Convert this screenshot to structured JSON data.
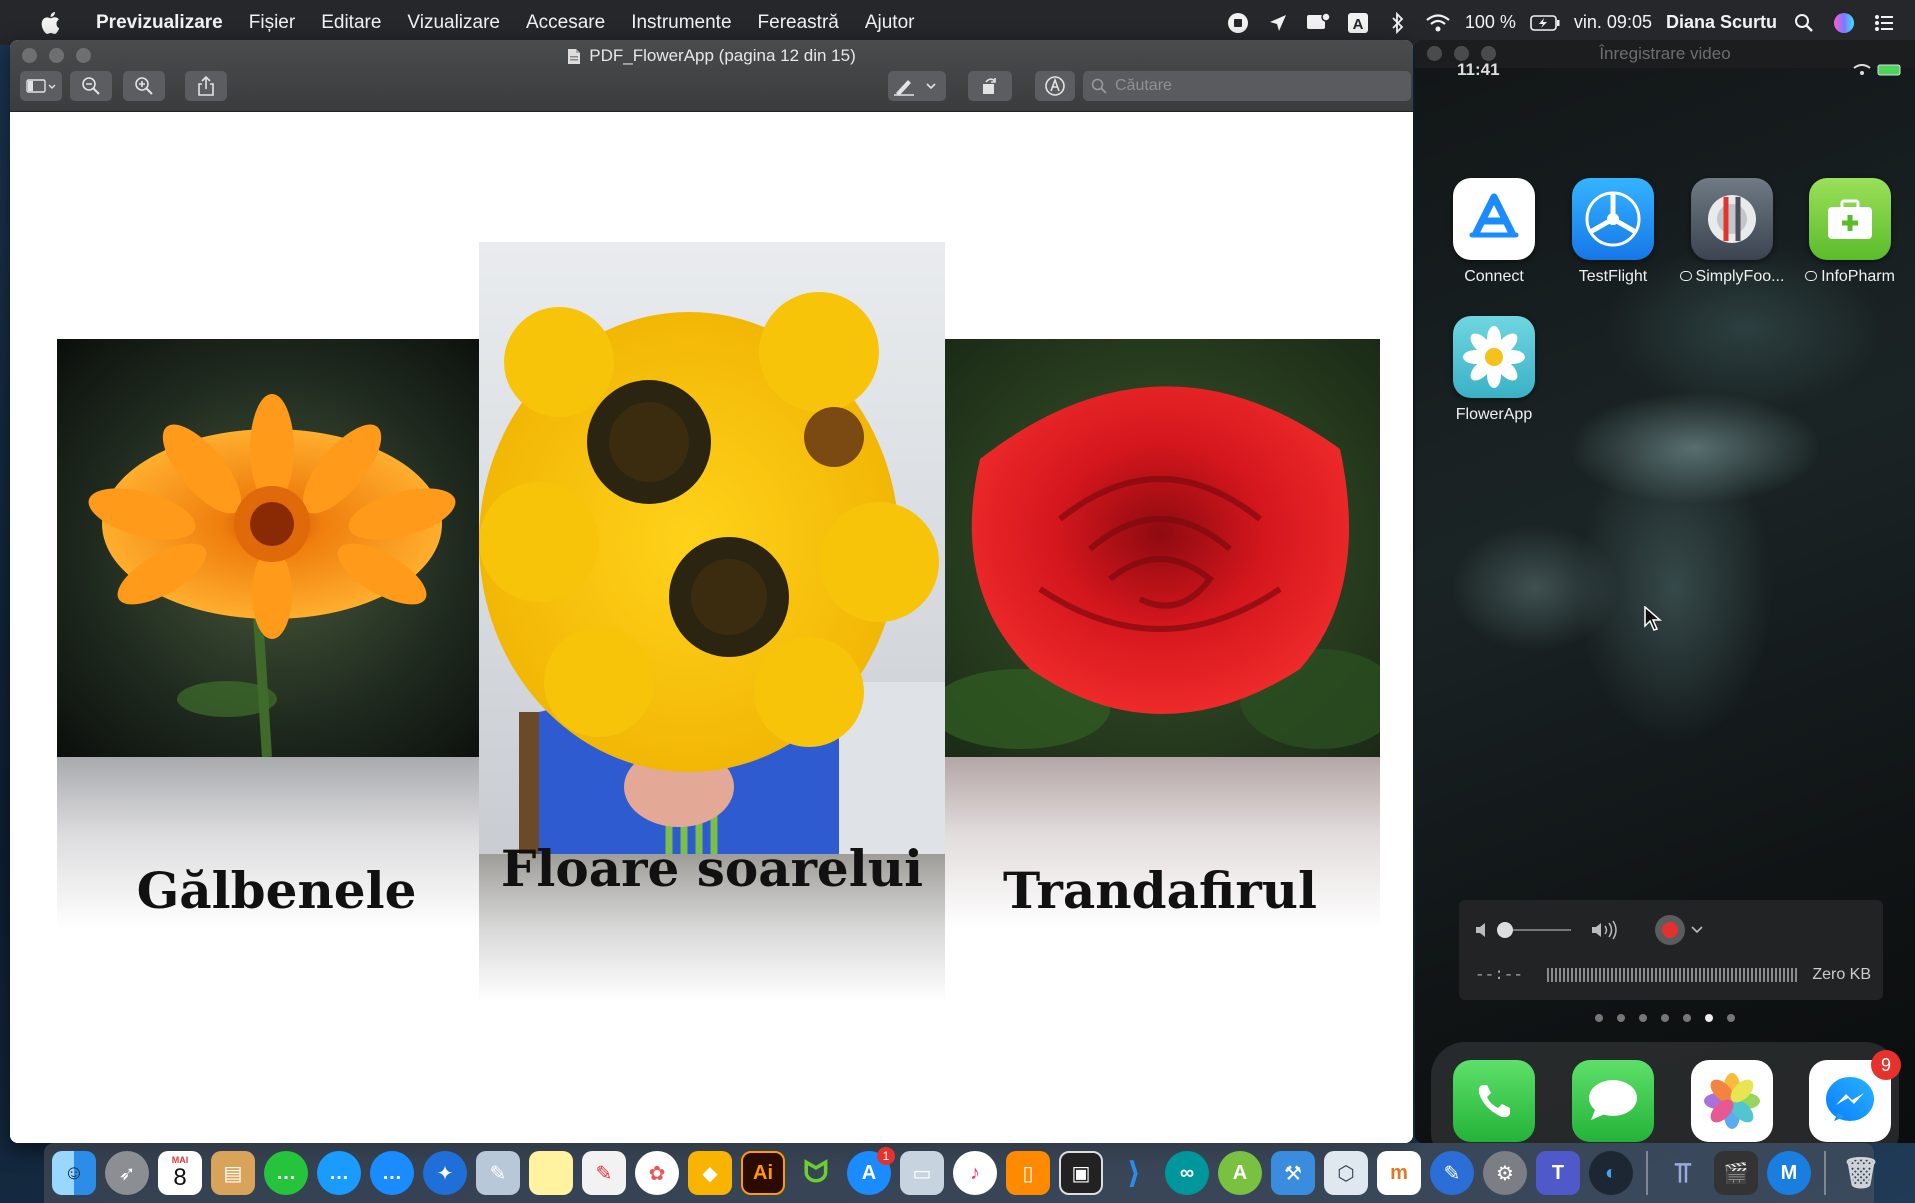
{
  "menubar": {
    "app_name": "Previzualizare",
    "menus": [
      "Fișier",
      "Editare",
      "Vizualizare",
      "Accesare",
      "Instrumente",
      "Fereastră",
      "Ajutor"
    ],
    "battery": "100 %",
    "clock": "vin. 09:05",
    "user": "Diana Scurtu",
    "icons": [
      "apple-logo-icon",
      "screen-record-icon",
      "location-arrow-icon",
      "notification-icon",
      "input-source-icon",
      "bluetooth-icon",
      "wifi-icon",
      "battery-icon",
      "spotlight-search-icon",
      "siri-icon",
      "control-center-icon"
    ]
  },
  "preview": {
    "title": "PDF_FlowerApp (pagina 12 din 15)",
    "search_placeholder": "Căutare",
    "toolbar_icons": [
      "sidebar-icon",
      "zoom-out-icon",
      "zoom-in-icon",
      "share-icon",
      "markup-pen-icon",
      "rotate-icon",
      "annotate-icon",
      "search-icon"
    ],
    "cards": [
      {
        "caption": "Gălbenele",
        "color": "#f08a10"
      },
      {
        "caption": "Floare soarelui",
        "color": "#f5c518"
      },
      {
        "caption": "Trandafirul",
        "color": "#d11a1f"
      }
    ]
  },
  "device": {
    "window_title": "Înregistrare video",
    "status_time": "11:41",
    "apps": [
      {
        "label": "Connect",
        "icon": "app-store-connect-icon"
      },
      {
        "label": "TestFlight",
        "icon": "testflight-icon"
      },
      {
        "label": "SimplyFoo...",
        "icon": "simplyfood-icon"
      },
      {
        "label": "InfoPharm",
        "icon": "infopharm-icon"
      },
      {
        "label": "FlowerApp",
        "icon": "flowerapp-icon"
      }
    ],
    "recorder": {
      "time": "--:--",
      "size": "Zero KB"
    },
    "dock": [
      {
        "name": "phone-icon"
      },
      {
        "name": "messages-icon"
      },
      {
        "name": "photos-icon"
      },
      {
        "name": "messenger-icon",
        "badge": "9"
      }
    ]
  },
  "mac_dock": {
    "calendar_day": "8",
    "calendar_month": "MAI",
    "app_store_badge": "1",
    "illustrator_label": "Ai"
  }
}
